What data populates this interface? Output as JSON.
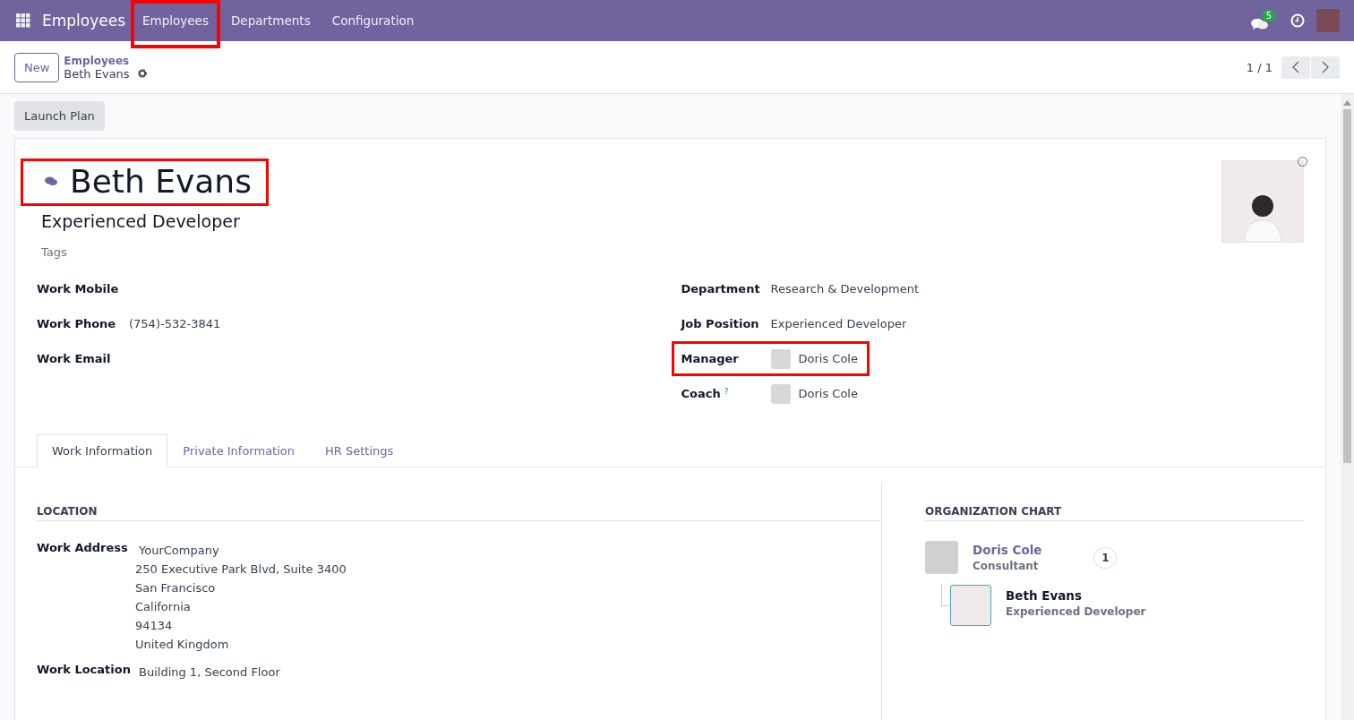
{
  "navbar": {
    "app_name": "Employees",
    "menu": [
      {
        "label": "Employees",
        "highlighted": true
      },
      {
        "label": "Departments",
        "highlighted": false
      },
      {
        "label": "Configuration",
        "highlighted": false
      }
    ],
    "messages_badge": "5"
  },
  "control_panel": {
    "new_button": "New",
    "breadcrumb": {
      "parent": "Employees",
      "current": "Beth Evans"
    },
    "pager": "1 / 1"
  },
  "action_buttons": [
    "Launch Plan"
  ],
  "employee": {
    "name": "Beth Evans",
    "name_highlighted": true,
    "job_title": "Experienced Developer",
    "tags_placeholder": "Tags"
  },
  "left_fields": [
    {
      "label": "Work Mobile",
      "kind": "text"
    },
    {
      "label": "Work Phone",
      "kind": "text",
      "value": "(754)-532-3841"
    },
    {
      "label": "Work Email",
      "kind": "text"
    }
  ],
  "right_fields": [
    {
      "label": "Department",
      "kind": "text",
      "value": "Research & Development",
      "highlighted": false
    },
    {
      "label": "Job Position",
      "kind": "text",
      "value": "Experienced Developer",
      "highlighted": false
    },
    {
      "label": "Manager",
      "kind": "person",
      "value": "Doris Cole",
      "highlighted": true
    },
    {
      "label": "Coach",
      "kind": "person",
      "value": "Doris Cole",
      "help": "?",
      "highlighted": false
    }
  ],
  "tabs": [
    {
      "label": "Work Information",
      "selected": true
    },
    {
      "label": "Private Information",
      "selected": false
    },
    {
      "label": "HR Settings",
      "selected": false
    }
  ],
  "location": {
    "title": "LOCATION",
    "fields": [
      {
        "label": "Work Address",
        "lines": [
          "YourCompany",
          "250 Executive Park Blvd, Suite 3400",
          "San Francisco",
          "California",
          "94134",
          "United Kingdom"
        ]
      },
      {
        "label": "Work Location",
        "lines": [
          "Building 1, Second Floor"
        ]
      }
    ]
  },
  "org_chart": {
    "title": "ORGANIZATION CHART",
    "manager": {
      "name": "Doris Cole",
      "job": "Consultant",
      "count": "1"
    },
    "employee": {
      "name": "Beth Evans",
      "job": "Experienced Developer"
    }
  }
}
